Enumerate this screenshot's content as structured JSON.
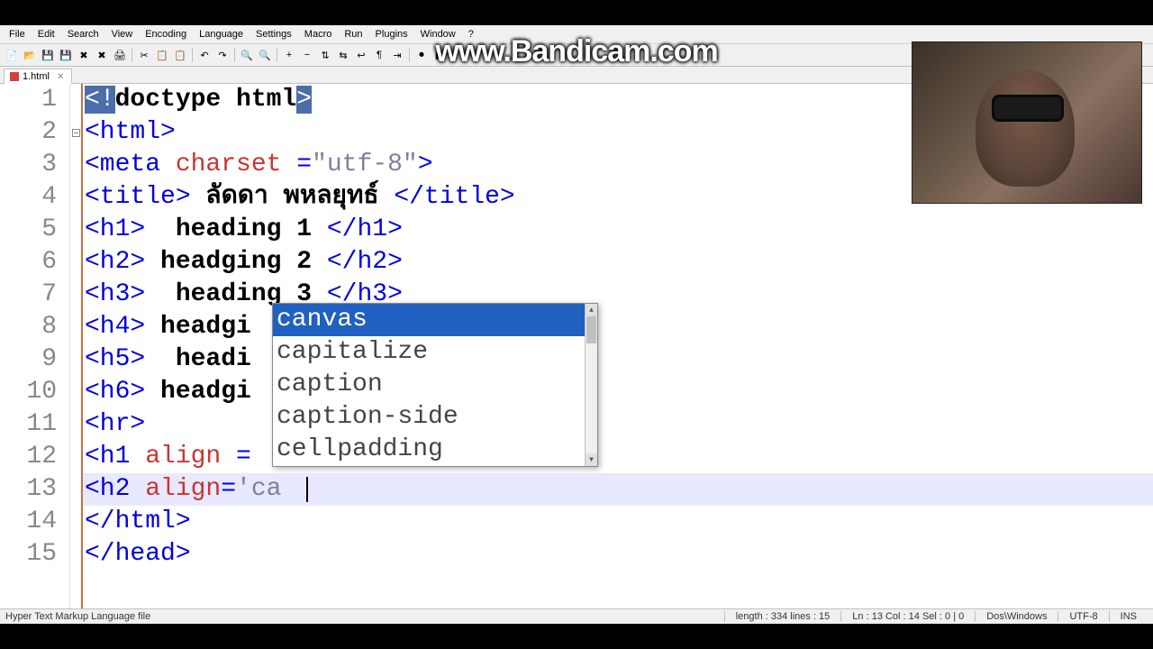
{
  "watermark": "www.Bandicam.com",
  "menu": {
    "items": [
      "File",
      "Edit",
      "Search",
      "View",
      "Encoding",
      "Language",
      "Settings",
      "Macro",
      "Run",
      "Plugins",
      "Window",
      "?"
    ]
  },
  "tab": {
    "name": "1.html"
  },
  "code": {
    "lines": [
      {
        "n": "1",
        "seg": [
          {
            "c": "hl",
            "t": "<!"
          },
          {
            "c": "txt",
            "t": "doctype html"
          },
          {
            "c": "hl",
            "t": ">"
          }
        ]
      },
      {
        "n": "2",
        "fold": true,
        "seg": [
          {
            "c": "tag",
            "t": "<html>"
          }
        ]
      },
      {
        "n": "3",
        "seg": [
          {
            "c": "tag",
            "t": "<meta "
          },
          {
            "c": "attr",
            "t": "charset "
          },
          {
            "c": "tag",
            "t": "="
          },
          {
            "c": "str",
            "t": "\"utf-8\""
          },
          {
            "c": "tag",
            "t": ">"
          }
        ]
      },
      {
        "n": "4",
        "seg": [
          {
            "c": "tag",
            "t": "<title>"
          },
          {
            "c": "txt",
            "t": " ลัดดา พหลยุทธ์ "
          },
          {
            "c": "tag",
            "t": "</title>"
          }
        ]
      },
      {
        "n": "5",
        "seg": [
          {
            "c": "tag",
            "t": "<h1>"
          },
          {
            "c": "txt",
            "t": "  heading 1 "
          },
          {
            "c": "tag",
            "t": "</h1>"
          }
        ]
      },
      {
        "n": "6",
        "seg": [
          {
            "c": "tag",
            "t": "<h2>"
          },
          {
            "c": "txt",
            "t": " headging 2 "
          },
          {
            "c": "tag",
            "t": "</h2>"
          }
        ]
      },
      {
        "n": "7",
        "seg": [
          {
            "c": "tag",
            "t": "<h3>"
          },
          {
            "c": "txt",
            "t": "  heading 3 "
          },
          {
            "c": "tag",
            "t": "</h3>"
          }
        ]
      },
      {
        "n": "8",
        "seg": [
          {
            "c": "tag",
            "t": "<h4>"
          },
          {
            "c": "txt",
            "t": " headgi"
          }
        ]
      },
      {
        "n": "9",
        "seg": [
          {
            "c": "tag",
            "t": "<h5>"
          },
          {
            "c": "txt",
            "t": "  headi"
          }
        ]
      },
      {
        "n": "10",
        "seg": [
          {
            "c": "tag",
            "t": "<h6>"
          },
          {
            "c": "txt",
            "t": " headgi"
          }
        ]
      },
      {
        "n": "11",
        "seg": [
          {
            "c": "tag",
            "t": "<hr>"
          }
        ]
      },
      {
        "n": "12",
        "seg": [
          {
            "c": "tag",
            "t": "<h1 "
          },
          {
            "c": "attr",
            "t": "align "
          },
          {
            "c": "tag",
            "t": "="
          }
        ]
      },
      {
        "n": "13",
        "cur": true,
        "seg": [
          {
            "c": "tag",
            "t": "<h2 "
          },
          {
            "c": "attr",
            "t": "align"
          },
          {
            "c": "tag",
            "t": "="
          },
          {
            "c": "str",
            "t": "'ca"
          }
        ]
      },
      {
        "n": "14",
        "seg": [
          {
            "c": "tag",
            "t": "</html>"
          }
        ]
      },
      {
        "n": "15",
        "seg": [
          {
            "c": "tag",
            "t": "</head>"
          }
        ]
      }
    ]
  },
  "autocomplete": {
    "items": [
      "canvas",
      "capitalize",
      "caption",
      "caption-side",
      "cellpadding"
    ],
    "selected": 0
  },
  "status": {
    "lang": "Hyper Text Markup Language file",
    "length": "length : 334    lines : 15",
    "pos": "Ln : 13    Col : 14    Sel : 0 | 0",
    "eol": "Dos\\Windows",
    "enc": "UTF-8",
    "mode": "INS"
  }
}
